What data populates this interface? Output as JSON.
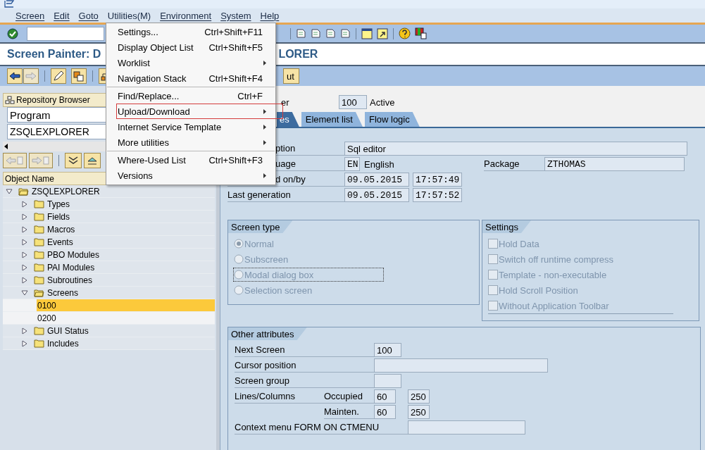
{
  "menubar": [
    {
      "label": "Screen",
      "selected": false
    },
    {
      "label": "Edit",
      "selected": false
    },
    {
      "label": "Goto",
      "selected": false
    },
    {
      "label": "Utilities(M)",
      "selected": true
    },
    {
      "label": "Environment",
      "selected": false
    },
    {
      "label": "System",
      "selected": false
    },
    {
      "label": "Help",
      "selected": false
    }
  ],
  "utilities_menu": [
    {
      "kind": "item",
      "label": "Settings...",
      "shortcut": "Ctrl+Shift+F11",
      "outlined": false
    },
    {
      "kind": "item",
      "label": "Display Object List",
      "shortcut": "Ctrl+Shift+F5",
      "outlined": false
    },
    {
      "kind": "submenu",
      "label": "Worklist",
      "outlined": false
    },
    {
      "kind": "item",
      "label": "Navigation Stack",
      "shortcut": "Ctrl+Shift+F4",
      "outlined": false
    },
    {
      "kind": "separator"
    },
    {
      "kind": "item",
      "label": "Find/Replace...",
      "shortcut": "Ctrl+F",
      "outlined": false
    },
    {
      "kind": "submenu",
      "label": "Upload/Download",
      "outlined": true
    },
    {
      "kind": "submenu",
      "label": "Internet Service Template",
      "outlined": false
    },
    {
      "kind": "submenu",
      "label": "More utilities",
      "outlined": false
    },
    {
      "kind": "separator"
    },
    {
      "kind": "item",
      "label": "Where-Used List",
      "shortcut": "Ctrl+Shift+F3",
      "outlined": false
    },
    {
      "kind": "submenu",
      "label": "Versions",
      "outlined": false
    }
  ],
  "title": {
    "left": "Screen Painter: D",
    "right": "LORER"
  },
  "app_toolbar": {
    "partial_button": "ut"
  },
  "repository_browser": {
    "title": "Repository Browser",
    "object_type": "Program",
    "object_name": "ZSQLEXPLORER",
    "column_header": "Object Name",
    "tree": [
      {
        "kind": "folder",
        "label": "ZSQLEXPLORER",
        "expanded": true,
        "selected": false,
        "children": [
          {
            "kind": "folder",
            "label": "Types",
            "expanded": false,
            "selected": false
          },
          {
            "kind": "folder",
            "label": "Fields",
            "expanded": false,
            "selected": false
          },
          {
            "kind": "folder",
            "label": "Macros",
            "expanded": false,
            "selected": false
          },
          {
            "kind": "folder",
            "label": "Events",
            "expanded": false,
            "selected": false
          },
          {
            "kind": "folder",
            "label": "PBO Modules",
            "expanded": false,
            "selected": false
          },
          {
            "kind": "folder",
            "label": "PAI Modules",
            "expanded": false,
            "selected": false
          },
          {
            "kind": "folder",
            "label": "Subroutines",
            "expanded": false,
            "selected": false
          },
          {
            "kind": "folder",
            "label": "Screens",
            "expanded": true,
            "selected": false,
            "children": [
              {
                "kind": "leaf",
                "label": "0100",
                "selected": true
              },
              {
                "kind": "leaf",
                "label": "0200",
                "selected": false
              }
            ]
          },
          {
            "kind": "folder",
            "label": "GUI Status",
            "expanded": false,
            "selected": false
          },
          {
            "kind": "folder",
            "label": "Includes",
            "expanded": false,
            "selected": false
          }
        ]
      }
    ]
  },
  "screen_header": {
    "label": "er",
    "number": "100",
    "status": "Active"
  },
  "tabs": [
    {
      "label": "es",
      "selected": true
    },
    {
      "label": "Element list",
      "selected": false
    },
    {
      "label": "Flow logic",
      "selected": false
    }
  ],
  "attributes": {
    "description": {
      "label": "ption",
      "value": "Sql editor"
    },
    "language": {
      "label": "uage",
      "code": "EN",
      "name": "English"
    },
    "package": {
      "label": "Package",
      "value": "ZTHOMAS"
    },
    "last_changed": {
      "label": "d on/by",
      "date": "09.05.2015",
      "time": "17:57:49"
    },
    "last_generation": {
      "label": "Last generation",
      "date": "09.05.2015",
      "time": "17:57:52"
    }
  },
  "screen_type": {
    "title": "Screen type",
    "options": [
      {
        "label": "Normal",
        "selected": true,
        "disabled": true,
        "focused": false
      },
      {
        "label": "Subscreen",
        "selected": false,
        "disabled": true,
        "focused": false
      },
      {
        "label": "Modal dialog box",
        "selected": false,
        "disabled": true,
        "focused": true
      },
      {
        "label": "Selection screen",
        "selected": false,
        "disabled": true,
        "focused": false
      }
    ]
  },
  "settings": {
    "title": "Settings",
    "options": [
      {
        "label": "Hold Data",
        "checked": false,
        "disabled": true
      },
      {
        "label": "Switch off runtime compress",
        "checked": false,
        "disabled": true
      },
      {
        "label": "Template - non-executable",
        "checked": false,
        "disabled": true
      },
      {
        "label": "Hold Scroll Position",
        "checked": false,
        "disabled": true
      },
      {
        "label": "Without Application Toolbar",
        "checked": false,
        "disabled": true
      }
    ]
  },
  "other_attributes": {
    "title": "Other attributes",
    "next_screen": {
      "label": "Next Screen",
      "value": "100"
    },
    "cursor_position": {
      "label": "Cursor position"
    },
    "screen_group": {
      "label": "Screen group"
    },
    "lines_columns": {
      "label": "Lines/Columns",
      "occupied_label": "Occupied",
      "occupied_lines": "60",
      "occupied_columns": "250",
      "mainten_label": "Mainten.",
      "mainten_lines": "60",
      "mainten_columns": "250"
    },
    "context_menu": {
      "label": "Context menu FORM ON CTMENU"
    }
  }
}
